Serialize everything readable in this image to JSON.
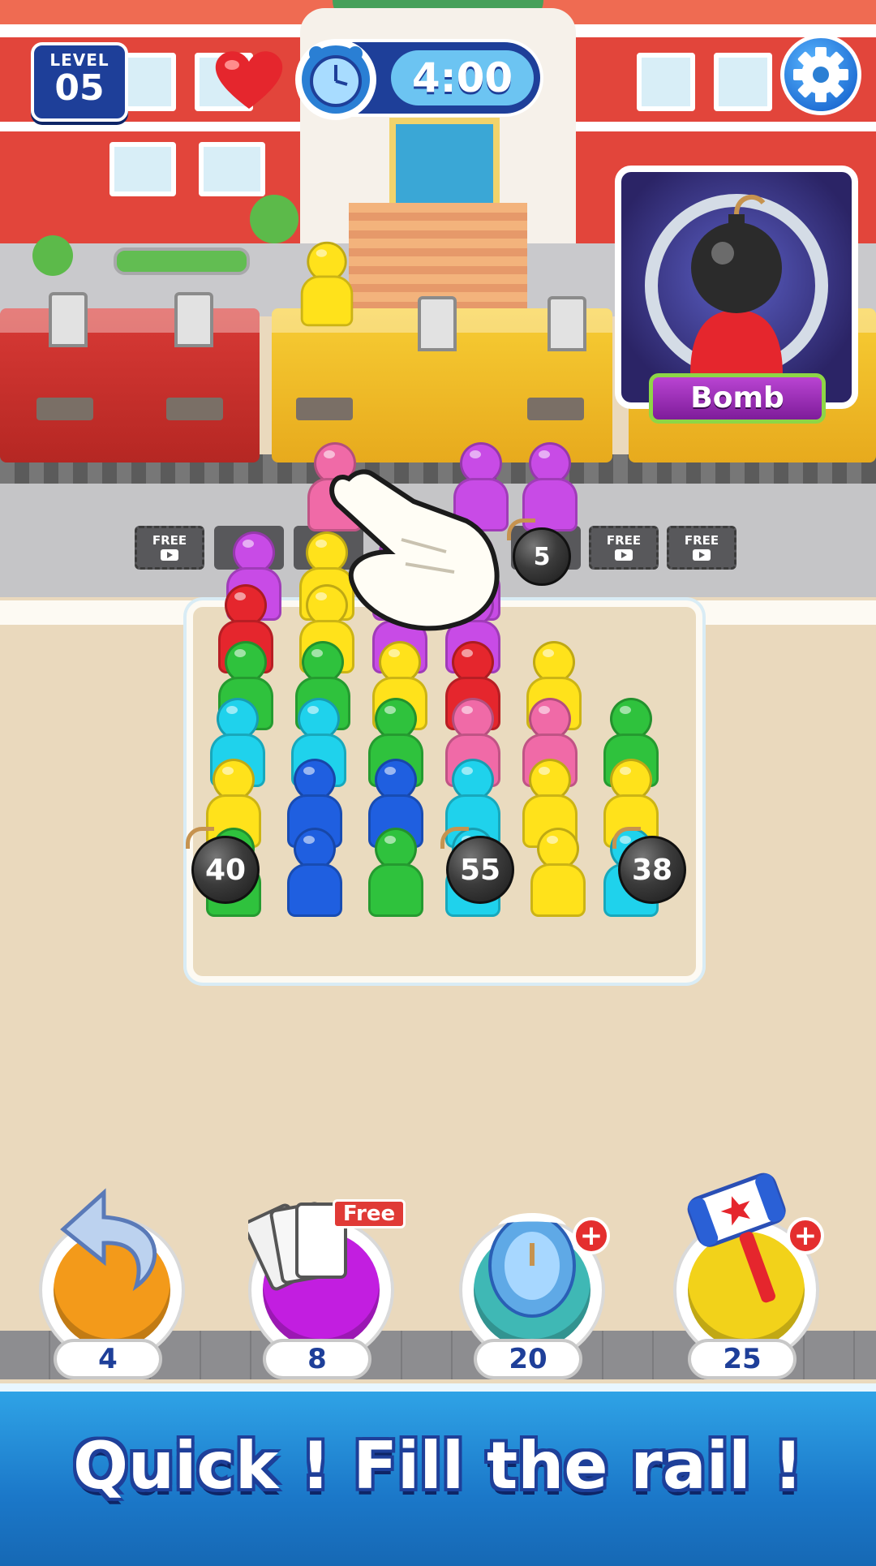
{
  "hud": {
    "level_label": "LEVEL",
    "level_number": "05",
    "timer": "4:00",
    "lives_icon": "heart-icon",
    "settings_icon": "gear-icon"
  },
  "powerup_card": {
    "label": "Bomb",
    "icon": "bomb-character-icon"
  },
  "slots": [
    {
      "label": "FREE",
      "icon": "video-play-icon"
    },
    {
      "label": "FREE",
      "icon": "video-play-icon"
    },
    {
      "label": "FREE",
      "icon": "video-play-icon"
    }
  ],
  "bombs": [
    {
      "value": "5"
    },
    {
      "value": "40"
    },
    {
      "value": "55"
    },
    {
      "value": "38"
    }
  ],
  "boosters": [
    {
      "name": "undo",
      "icon": "undo-arrow-icon",
      "count": "4",
      "color": "#f39a1a"
    },
    {
      "name": "shuffle",
      "icon": "cards-icon",
      "count": "8",
      "color": "#c21ee0",
      "tag": "Free"
    },
    {
      "name": "freeze",
      "icon": "frozen-clock-icon",
      "count": "20",
      "color": "#3fb8b5",
      "plus": "+"
    },
    {
      "name": "hammer",
      "icon": "hammer-icon",
      "count": "25",
      "color": "#f2d21a",
      "plus": "+"
    }
  ],
  "banner": {
    "text": "Quick ! Fill the rail !"
  },
  "colors": {
    "red": "#e5262d",
    "yellow": "#ffe21b",
    "green": "#2fc23d",
    "cyan": "#1fd2ec",
    "blue": "#1f5fe0",
    "pink": "#f06aa7",
    "purple": "#c84be6",
    "level_badge": "#1e3f99",
    "banner": "#1b78c9"
  }
}
